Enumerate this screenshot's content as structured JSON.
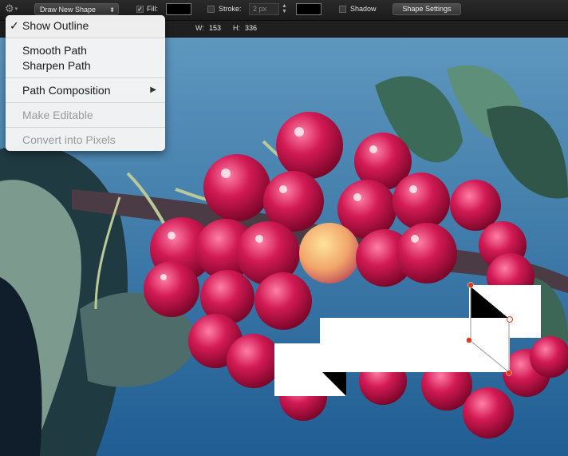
{
  "toolbar": {
    "shape_mode": "Draw New Shape",
    "fill_label": "Fill:",
    "fill_checked": true,
    "fill_color": "#000000",
    "stroke_label": "Stroke:",
    "stroke_checked": false,
    "stroke_width": "2 px",
    "stroke_color": "#000000",
    "shadow_label": "Shadow",
    "shadow_checked": false,
    "settings_button": "Shape Settings"
  },
  "dimensions": {
    "w_label": "W:",
    "w_value": "153",
    "h_label": "H:",
    "h_value": "336"
  },
  "menu": {
    "show_outline_check": "✓",
    "show_outline": "Show Outline",
    "smooth_path": "Smooth Path",
    "sharpen_path": "Sharpen Path",
    "path_composition": "Path Composition",
    "make_editable": "Make Editable",
    "convert_pixels": "Convert into Pixels"
  },
  "colors": {
    "sky": "#2b6a9a",
    "cherry": "#c8184e",
    "anchor": "#e23a1a",
    "shape_fill": "#ffffff"
  },
  "icons": [
    "gear-icon",
    "submenu-arrow-icon",
    "checkmark-icon",
    "stepper-icon"
  ]
}
